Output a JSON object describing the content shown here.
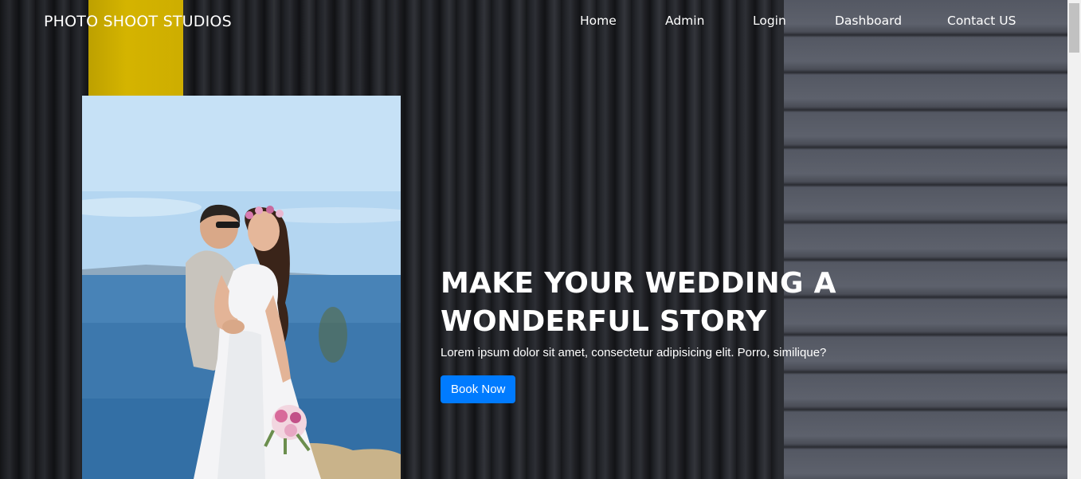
{
  "navbar": {
    "brand": "PHOTO SHOOT STUDIOS",
    "links": [
      "Home",
      "Admin",
      "Login",
      "Dashboard",
      "Contact US"
    ]
  },
  "hero": {
    "title": "MAKE YOUR WEDDING A WONDERFUL STORY",
    "subtitle": "Lorem ipsum dolor sit amet, consectetur adipisicing elit. Porro, similique?",
    "button_label": "Book Now",
    "photo_alt": "wedding-couple-photo"
  },
  "colors": {
    "button": "#007bff",
    "text": "#ffffff",
    "background": "#1f2024"
  }
}
